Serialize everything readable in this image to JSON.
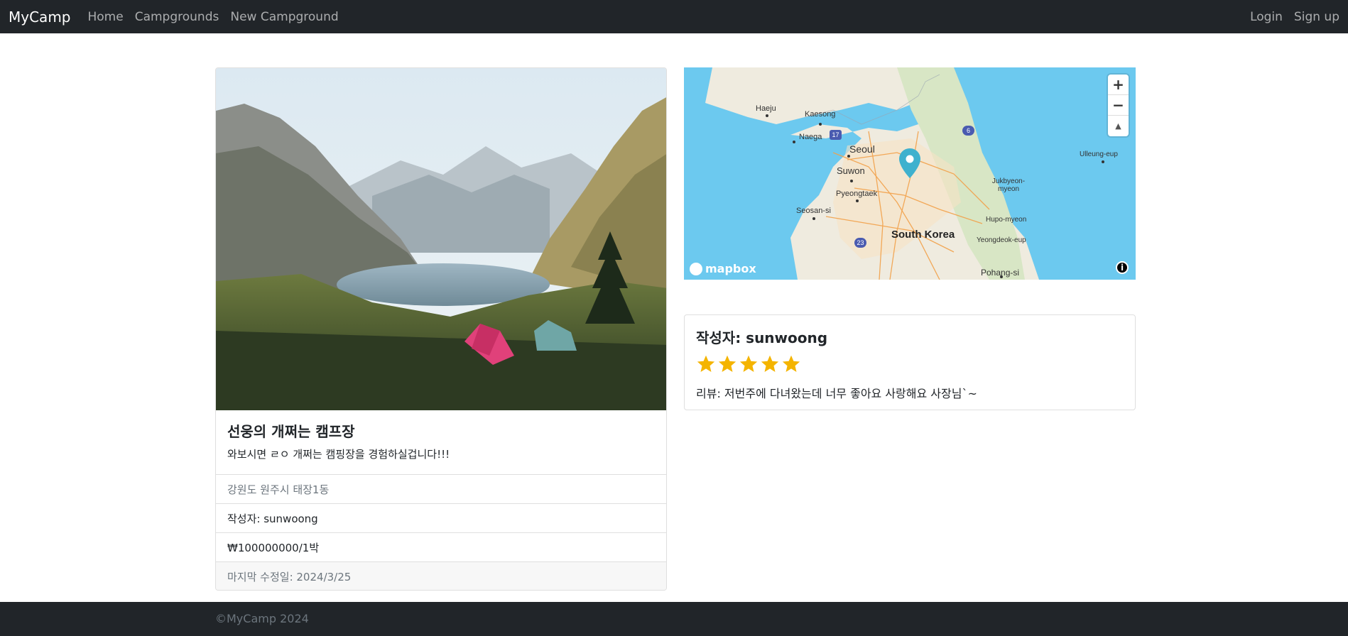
{
  "navbar": {
    "brand": "MyCamp",
    "links": [
      "Home",
      "Campgrounds",
      "New Campground"
    ],
    "right_links": [
      "Login",
      "Sign up"
    ]
  },
  "campground": {
    "title": "선웅의 개쩌는 캠프장",
    "description": "와보시면 ㄹㅇ 개쩌는 캠핑장을 경험하실겁니다!!!",
    "location": "강원도 원주시 태장1동",
    "author": "작성자: sunwoong",
    "price": "₩100000000/1박",
    "last_modified": "마지막 수정일: 2024/3/25"
  },
  "map": {
    "labels": [
      "Haeju",
      "Kaesong",
      "Naega",
      "Seoul",
      "Suwon",
      "Pyeongtaek",
      "Seosan-si",
      "South Korea",
      "Ulleung-eup",
      "Jukbyeon-myeon",
      "Hupo-myeon",
      "Yeongdeok-eup",
      "Pohang-si"
    ],
    "road_shields": [
      "17",
      "6",
      "23"
    ],
    "zoom_in": "+",
    "zoom_out": "−",
    "compass": "▲",
    "logo": "mapbox",
    "info": "i",
    "marker_color": "#3fb1ce"
  },
  "review": {
    "author": "작성자: sunwoong",
    "rating": 5,
    "max_rating": 5,
    "text": "리뷰: 저번주에 다녀왔는데 너무 좋아요 사랑해요 사장님`~",
    "star_color": "#f4b400"
  },
  "footer": {
    "text": "©MyCamp 2024"
  }
}
